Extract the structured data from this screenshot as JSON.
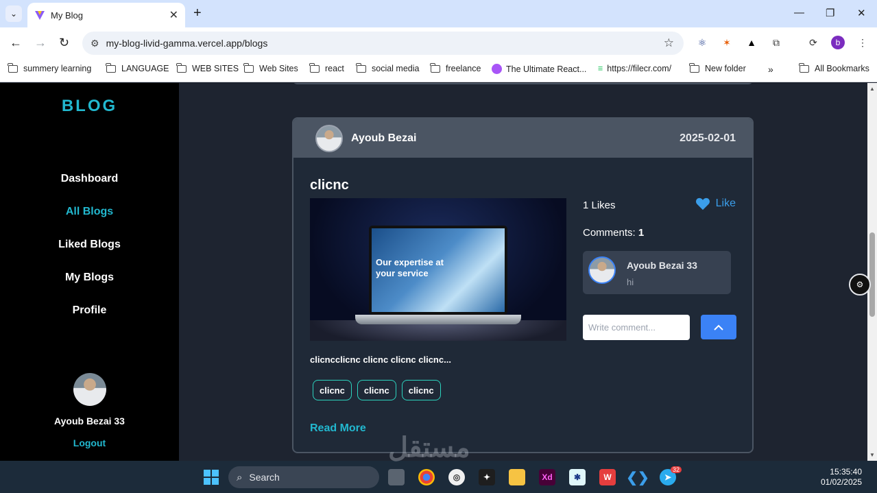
{
  "browser": {
    "tab_title": "My Blog",
    "url": "my-blog-livid-gamma.vercel.app/blogs",
    "bookmarks": [
      "summery learning",
      "LANGUAGE",
      "WEB SITES",
      "Web Sites",
      "react",
      "social media",
      "freelance",
      "The Ultimate React...",
      "https://filecr.com/",
      "New folder",
      "All Bookmarks"
    ],
    "profile_initial": "b"
  },
  "sidebar": {
    "brand": "BLOG",
    "nav": [
      "Dashboard",
      "All Blogs",
      "Liked Blogs",
      "My Blogs",
      "Profile"
    ],
    "active": "All Blogs",
    "user_name": "Ayoub Bezai 33",
    "logout_label": "Logout"
  },
  "post": {
    "author": "Ayoub Bezai",
    "date": "2025-02-01",
    "title": "clicnc",
    "image_text": "Our expertise at your service",
    "likes_text": "1 Likes",
    "like_label": "Like",
    "comments_label": "Comments:",
    "comments_count": "1",
    "comments": [
      {
        "author": "Ayoub Bezai 33",
        "text": "hi"
      }
    ],
    "comment_placeholder": "Write comment...",
    "excerpt": "clicncclicnc clicnc clicnc clicnc...",
    "tags": [
      "clicnc",
      "clicnc",
      "clicnc"
    ],
    "read_more": "Read More"
  },
  "taskbar": {
    "search_placeholder": "Search",
    "time": "15:35:40",
    "date": "01/02/2025",
    "telegram_badge": "32",
    "watermark": "مستقل"
  },
  "colors": {
    "accent": "#22b8cf",
    "card_bg": "#1f2937",
    "card_header": "#4b5563",
    "like_blue": "#3b9eea",
    "tag_border": "#2dd4bf"
  }
}
